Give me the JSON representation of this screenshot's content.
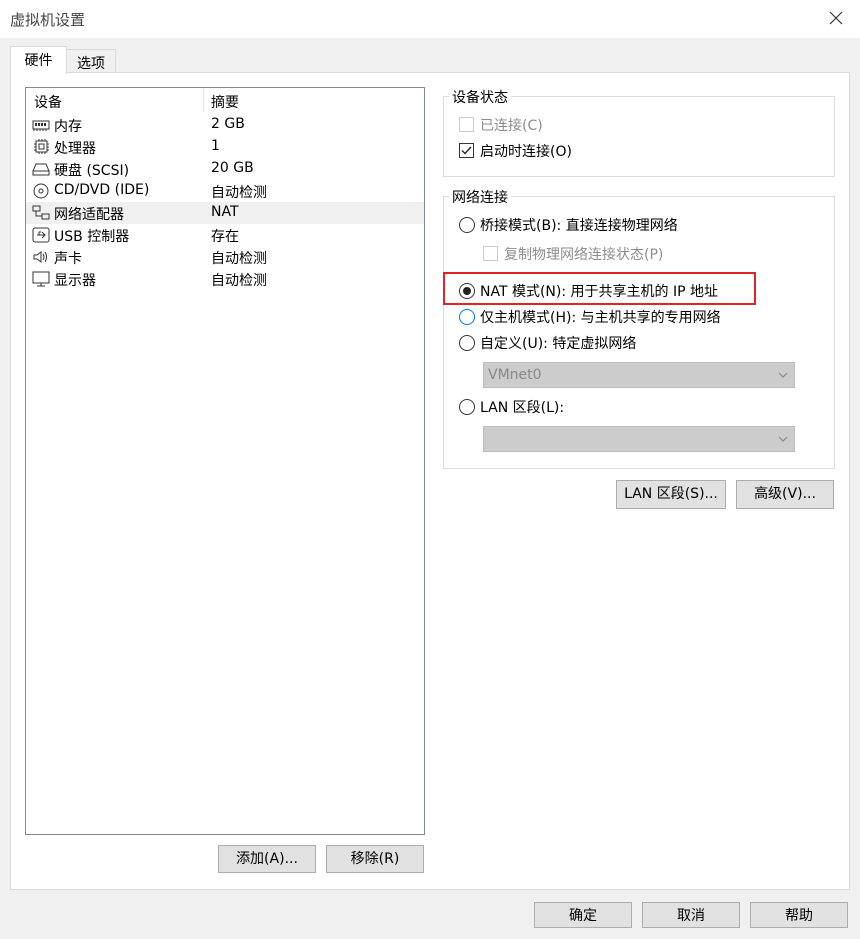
{
  "window": {
    "title": "虚拟机设置",
    "close_icon": "close-icon"
  },
  "tabs": [
    {
      "label": "硬件",
      "active": true
    },
    {
      "label": "选项",
      "active": false
    }
  ],
  "device_list": {
    "columns": [
      "设备",
      "摘要"
    ],
    "rows": [
      {
        "icon": "memory-icon",
        "name": "内存",
        "summary": "2 GB"
      },
      {
        "icon": "cpu-icon",
        "name": "处理器",
        "summary": "1"
      },
      {
        "icon": "hard-disk-icon",
        "name": "硬盘 (SCSI)",
        "summary": "20 GB"
      },
      {
        "icon": "cd-dvd-icon",
        "name": "CD/DVD (IDE)",
        "summary": "自动检测"
      },
      {
        "icon": "network-adapter-icon",
        "name": "网络适配器",
        "summary": "NAT",
        "selected": true
      },
      {
        "icon": "usb-icon",
        "name": "USB 控制器",
        "summary": "存在"
      },
      {
        "icon": "speaker-icon",
        "name": "声卡",
        "summary": "自动检测"
      },
      {
        "icon": "monitor-icon",
        "name": "显示器",
        "summary": "自动检测"
      }
    ]
  },
  "device_buttons": {
    "add": "添加(A)...",
    "remove": "移除(R)"
  },
  "device_status": {
    "title": "设备状态",
    "connected": {
      "label": "已连接(C)",
      "checked": false,
      "disabled": true
    },
    "connect_at_power_on": {
      "label": "启动时连接(O)",
      "checked": true
    }
  },
  "network_connection": {
    "title": "网络连接",
    "bridged": {
      "label": "桥接模式(B): 直接连接物理网络",
      "selected": false
    },
    "replicate": {
      "label": "复制物理网络连接状态(P)",
      "checked": false,
      "disabled": true
    },
    "nat": {
      "label": "NAT 模式(N): 用于共享主机的 IP 地址",
      "selected": true
    },
    "host_only": {
      "label": "仅主机模式(H): 与主机共享的专用网络",
      "selected": false
    },
    "custom": {
      "label": "自定义(U): 特定虚拟网络",
      "selected": false
    },
    "custom_select": {
      "value": "VMnet0",
      "disabled": true
    },
    "lan_segment": {
      "label": "LAN 区段(L):",
      "selected": false
    },
    "lan_select": {
      "value": "",
      "disabled": true
    }
  },
  "network_buttons": {
    "lan_segments": "LAN 区段(S)...",
    "advanced": "高级(V)..."
  },
  "footer_buttons": {
    "ok": "确定",
    "cancel": "取消",
    "help": "帮助"
  },
  "colors": {
    "highlight": "#e02424",
    "focus": "#0078d7"
  }
}
